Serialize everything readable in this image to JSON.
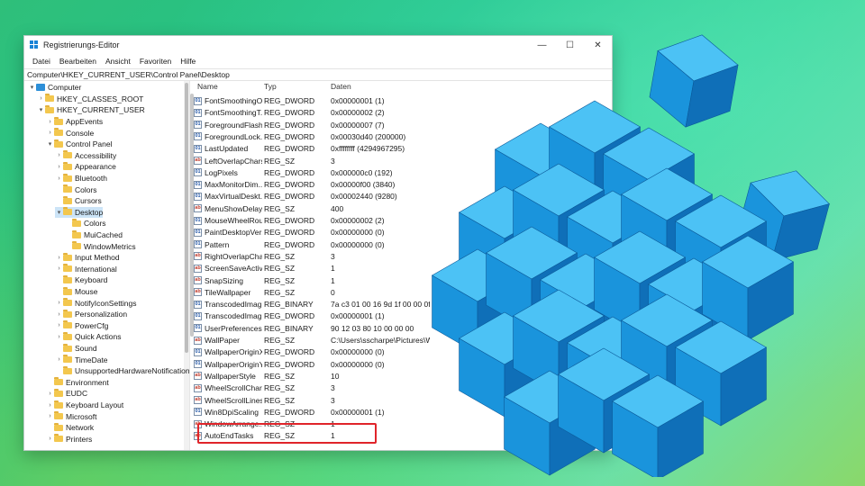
{
  "window": {
    "title": "Registrierungs-Editor",
    "controls": {
      "minimize": "—",
      "maximize": "☐",
      "close": "✕"
    }
  },
  "menu": [
    "Datei",
    "Bearbeiten",
    "Ansicht",
    "Favoriten",
    "Hilfe"
  ],
  "address": "Computer\\HKEY_CURRENT_USER\\Control Panel\\Desktop",
  "tree": [
    {
      "label": "Computer",
      "level": 0,
      "arrow": "▾",
      "icon": "computer-icon"
    },
    {
      "label": "HKEY_CLASSES_ROOT",
      "level": 1,
      "arrow": "›",
      "icon": "folder-icon"
    },
    {
      "label": "HKEY_CURRENT_USER",
      "level": 1,
      "arrow": "▾",
      "icon": "folder-icon"
    },
    {
      "label": "AppEvents",
      "level": 2,
      "arrow": "›",
      "icon": "folder-icon"
    },
    {
      "label": "Console",
      "level": 2,
      "arrow": "›",
      "icon": "folder-icon"
    },
    {
      "label": "Control Panel",
      "level": 2,
      "arrow": "▾",
      "icon": "folder-icon"
    },
    {
      "label": "Accessibility",
      "level": 3,
      "arrow": "›",
      "icon": "folder-icon"
    },
    {
      "label": "Appearance",
      "level": 3,
      "arrow": "›",
      "icon": "folder-icon"
    },
    {
      "label": "Bluetooth",
      "level": 3,
      "arrow": "›",
      "icon": "folder-icon"
    },
    {
      "label": "Colors",
      "level": 3,
      "arrow": "",
      "icon": "folder-icon"
    },
    {
      "label": "Cursors",
      "level": 3,
      "arrow": "",
      "icon": "folder-icon"
    },
    {
      "label": "Desktop",
      "level": 3,
      "arrow": "▾",
      "icon": "folder-icon",
      "selected": true
    },
    {
      "label": "Colors",
      "level": 4,
      "arrow": "",
      "icon": "folder-icon"
    },
    {
      "label": "MuiCached",
      "level": 4,
      "arrow": "",
      "icon": "folder-icon"
    },
    {
      "label": "WindowMetrics",
      "level": 4,
      "arrow": "",
      "icon": "folder-icon"
    },
    {
      "label": "Input Method",
      "level": 3,
      "arrow": "›",
      "icon": "folder-icon"
    },
    {
      "label": "International",
      "level": 3,
      "arrow": "›",
      "icon": "folder-icon"
    },
    {
      "label": "Keyboard",
      "level": 3,
      "arrow": "",
      "icon": "folder-icon"
    },
    {
      "label": "Mouse",
      "level": 3,
      "arrow": "",
      "icon": "folder-icon"
    },
    {
      "label": "NotifyIconSettings",
      "level": 3,
      "arrow": "›",
      "icon": "folder-icon"
    },
    {
      "label": "Personalization",
      "level": 3,
      "arrow": "›",
      "icon": "folder-icon"
    },
    {
      "label": "PowerCfg",
      "level": 3,
      "arrow": "›",
      "icon": "folder-icon"
    },
    {
      "label": "Quick Actions",
      "level": 3,
      "arrow": "›",
      "icon": "folder-icon"
    },
    {
      "label": "Sound",
      "level": 3,
      "arrow": "",
      "icon": "folder-icon"
    },
    {
      "label": "TimeDate",
      "level": 3,
      "arrow": "›",
      "icon": "folder-icon"
    },
    {
      "label": "UnsupportedHardwareNotificationCach",
      "level": 3,
      "arrow": "",
      "icon": "folder-icon"
    },
    {
      "label": "Environment",
      "level": 2,
      "arrow": "",
      "icon": "folder-icon"
    },
    {
      "label": "EUDC",
      "level": 2,
      "arrow": "›",
      "icon": "folder-icon"
    },
    {
      "label": "Keyboard Layout",
      "level": 2,
      "arrow": "›",
      "icon": "folder-icon"
    },
    {
      "label": "Microsoft",
      "level": 2,
      "arrow": "›",
      "icon": "folder-icon"
    },
    {
      "label": "Network",
      "level": 2,
      "arrow": "",
      "icon": "folder-icon"
    },
    {
      "label": "Printers",
      "level": 2,
      "arrow": "›",
      "icon": "folder-icon"
    }
  ],
  "columns": {
    "name": "Name",
    "type": "Typ",
    "data": "Daten"
  },
  "values": [
    {
      "name": "FontSmoothingO...",
      "type": "REG_DWORD",
      "data": "0x00000001 (1)"
    },
    {
      "name": "FontSmoothingT...",
      "type": "REG_DWORD",
      "data": "0x00000002 (2)"
    },
    {
      "name": "ForegroundFlash...",
      "type": "REG_DWORD",
      "data": "0x00000007 (7)"
    },
    {
      "name": "ForegroundLock...",
      "type": "REG_DWORD",
      "data": "0x00030d40 (200000)"
    },
    {
      "name": "LastUpdated",
      "type": "REG_DWORD",
      "data": "0xffffffff (4294967295)"
    },
    {
      "name": "LeftOverlapChars",
      "type": "REG_SZ",
      "data": "3"
    },
    {
      "name": "LogPixels",
      "type": "REG_DWORD",
      "data": "0x000000c0 (192)"
    },
    {
      "name": "MaxMonitorDim...",
      "type": "REG_DWORD",
      "data": "0x00000f00 (3840)"
    },
    {
      "name": "MaxVirtualDeskt...",
      "type": "REG_DWORD",
      "data": "0x00002440 (9280)"
    },
    {
      "name": "MenuShowDelay",
      "type": "REG_SZ",
      "data": "400"
    },
    {
      "name": "MouseWheelRou...",
      "type": "REG_DWORD",
      "data": "0x00000002 (2)"
    },
    {
      "name": "PaintDesktopVers...",
      "type": "REG_DWORD",
      "data": "0x00000000 (0)"
    },
    {
      "name": "Pattern",
      "type": "REG_DWORD",
      "data": "0x00000000 (0)"
    },
    {
      "name": "RightOverlapChars",
      "type": "REG_SZ",
      "data": "3"
    },
    {
      "name": "ScreenSaveActive",
      "type": "REG_SZ",
      "data": "1"
    },
    {
      "name": "SnapSizing",
      "type": "REG_SZ",
      "data": "1"
    },
    {
      "name": "TileWallpaper",
      "type": "REG_SZ",
      "data": "0"
    },
    {
      "name": "TranscodedImag...",
      "type": "REG_BINARY",
      "data": "7a c3 01 00 16 9d 1f 00 00 0f 00 00"
    },
    {
      "name": "TranscodedImag...",
      "type": "REG_DWORD",
      "data": "0x00000001 (1)"
    },
    {
      "name": "UserPreferences...",
      "type": "REG_BINARY",
      "data": "90 12 03 80 10 00 00 00"
    },
    {
      "name": "WallPaper",
      "type": "REG_SZ",
      "data": "C:\\Users\\sscharpe\\Pictures\\Wallpap"
    },
    {
      "name": "WallpaperOriginX",
      "type": "REG_DWORD",
      "data": "0x00000000 (0)"
    },
    {
      "name": "WallpaperOriginY",
      "type": "REG_DWORD",
      "data": "0x00000000 (0)"
    },
    {
      "name": "WallpaperStyle",
      "type": "REG_SZ",
      "data": "10"
    },
    {
      "name": "WheelScrollChars",
      "type": "REG_SZ",
      "data": "3"
    },
    {
      "name": "WheelScrollLines",
      "type": "REG_SZ",
      "data": "3"
    },
    {
      "name": "Win8DpiScaling",
      "type": "REG_DWORD",
      "data": "0x00000001 (1)"
    },
    {
      "name": "WindowArrange...",
      "type": "REG_SZ",
      "data": "1"
    },
    {
      "name": "AutoEndTasks",
      "type": "REG_SZ",
      "data": "1",
      "highlighted": true
    }
  ],
  "colors": {
    "cube_light": "#4cc2f5",
    "cube_mid": "#1a94dc",
    "cube_dark": "#0f6fb8",
    "highlight": "#e0242a"
  }
}
